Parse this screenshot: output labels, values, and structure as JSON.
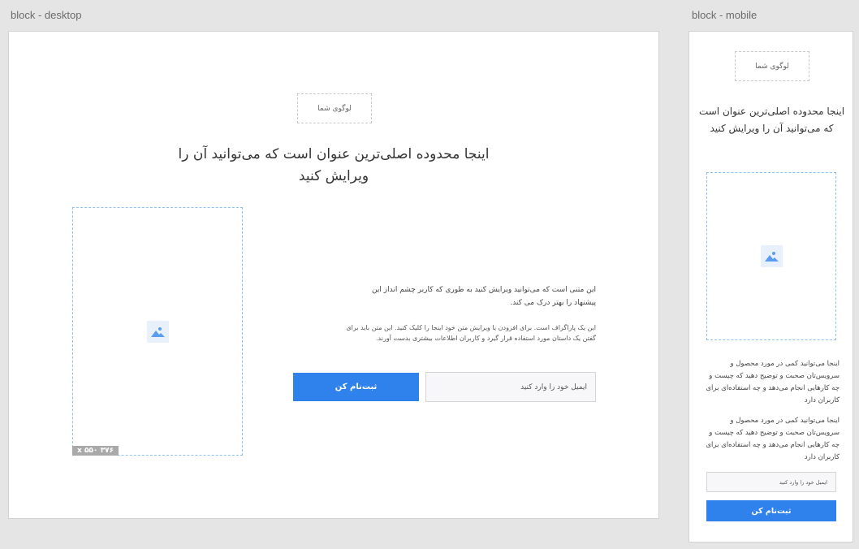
{
  "frames": {
    "desktop_label": "block - desktop",
    "mobile_label": "block - mobile"
  },
  "block": {
    "logo_text": "لوگوی شما",
    "headline": "اینجا محدوده اصلی‌ترین عنوان است که می‌توانید آن را ویرایش کنید",
    "image_size_tag": "۳۷۶ x ۵۵۰",
    "desktop_paragraph_1": "این متنی است که می‌توانید ویرایش کنید به طوری که کاربر چشم انداز این پیشنهاد را بهتر درک می کند.",
    "desktop_paragraph_2": "این یک پاراگراف است. برای افزودن یا ویرایش متن خود اینجا را کلیک کنید. این متن باید برای گفتن یک داستان مورد استفاده قرار گیرد و کاربران اطلاعات بیشتری بدست آورند.",
    "mobile_paragraph_1": "اینجا می‌توانید کمی در مورد محصول و سرویس‌تان صحبت و توضیح دهید که چیست و چه کارهایی انجام می‌دهد و چه استفاده‌ای برای کاربران دارد",
    "mobile_paragraph_2": "اینجا می‌توانید کمی در مورد محصول و سرویس‌تان صحبت و توضیح دهید که چیست و چه کارهایی انجام می‌دهد و چه استفاده‌ای برای کاربران دارد",
    "email_placeholder": "ایمیل خود را وارد کنید",
    "signup_label": "ثبت‌نام کن"
  },
  "colors": {
    "accent": "#2f82eb",
    "image_border": "#8ec1f2"
  },
  "icons": {
    "image_placeholder": "image-icon"
  }
}
